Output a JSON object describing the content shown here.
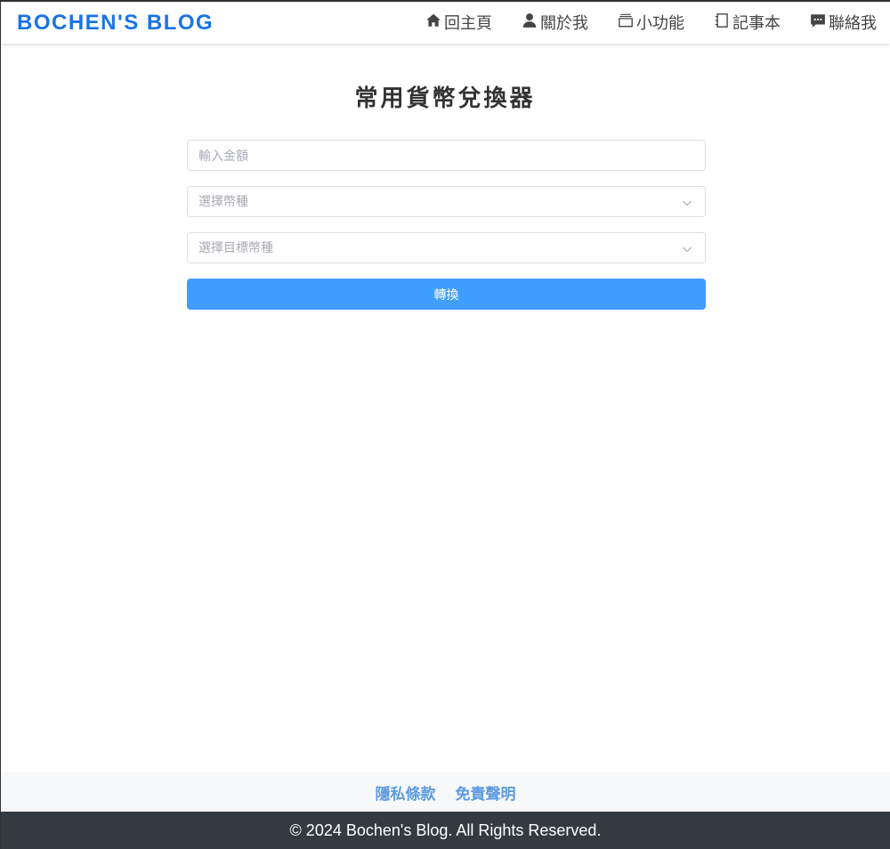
{
  "header": {
    "brand": "BOCHEN'S BLOG",
    "nav": [
      {
        "label": "回主頁",
        "icon": "home-icon"
      },
      {
        "label": "關於我",
        "icon": "user-icon"
      },
      {
        "label": "小功能",
        "icon": "tools-icon"
      },
      {
        "label": "記事本",
        "icon": "notebook-icon"
      },
      {
        "label": "聯絡我",
        "icon": "chat-icon"
      }
    ]
  },
  "main": {
    "title": "常用貨幣兌換器",
    "amount_placeholder": "輸入金額",
    "from_currency_placeholder": "選擇幣種",
    "to_currency_placeholder": "選擇目標幣種",
    "convert_label": "轉換"
  },
  "footer": {
    "links": [
      "隱私條款",
      "免責聲明"
    ],
    "copyright": "© 2024 Bochen's Blog. All Rights Reserved."
  },
  "colors": {
    "brand": "#1a73e8",
    "primary_button": "#409eff",
    "footer_bar": "#343a40",
    "footer_link": "#5e9be0"
  }
}
